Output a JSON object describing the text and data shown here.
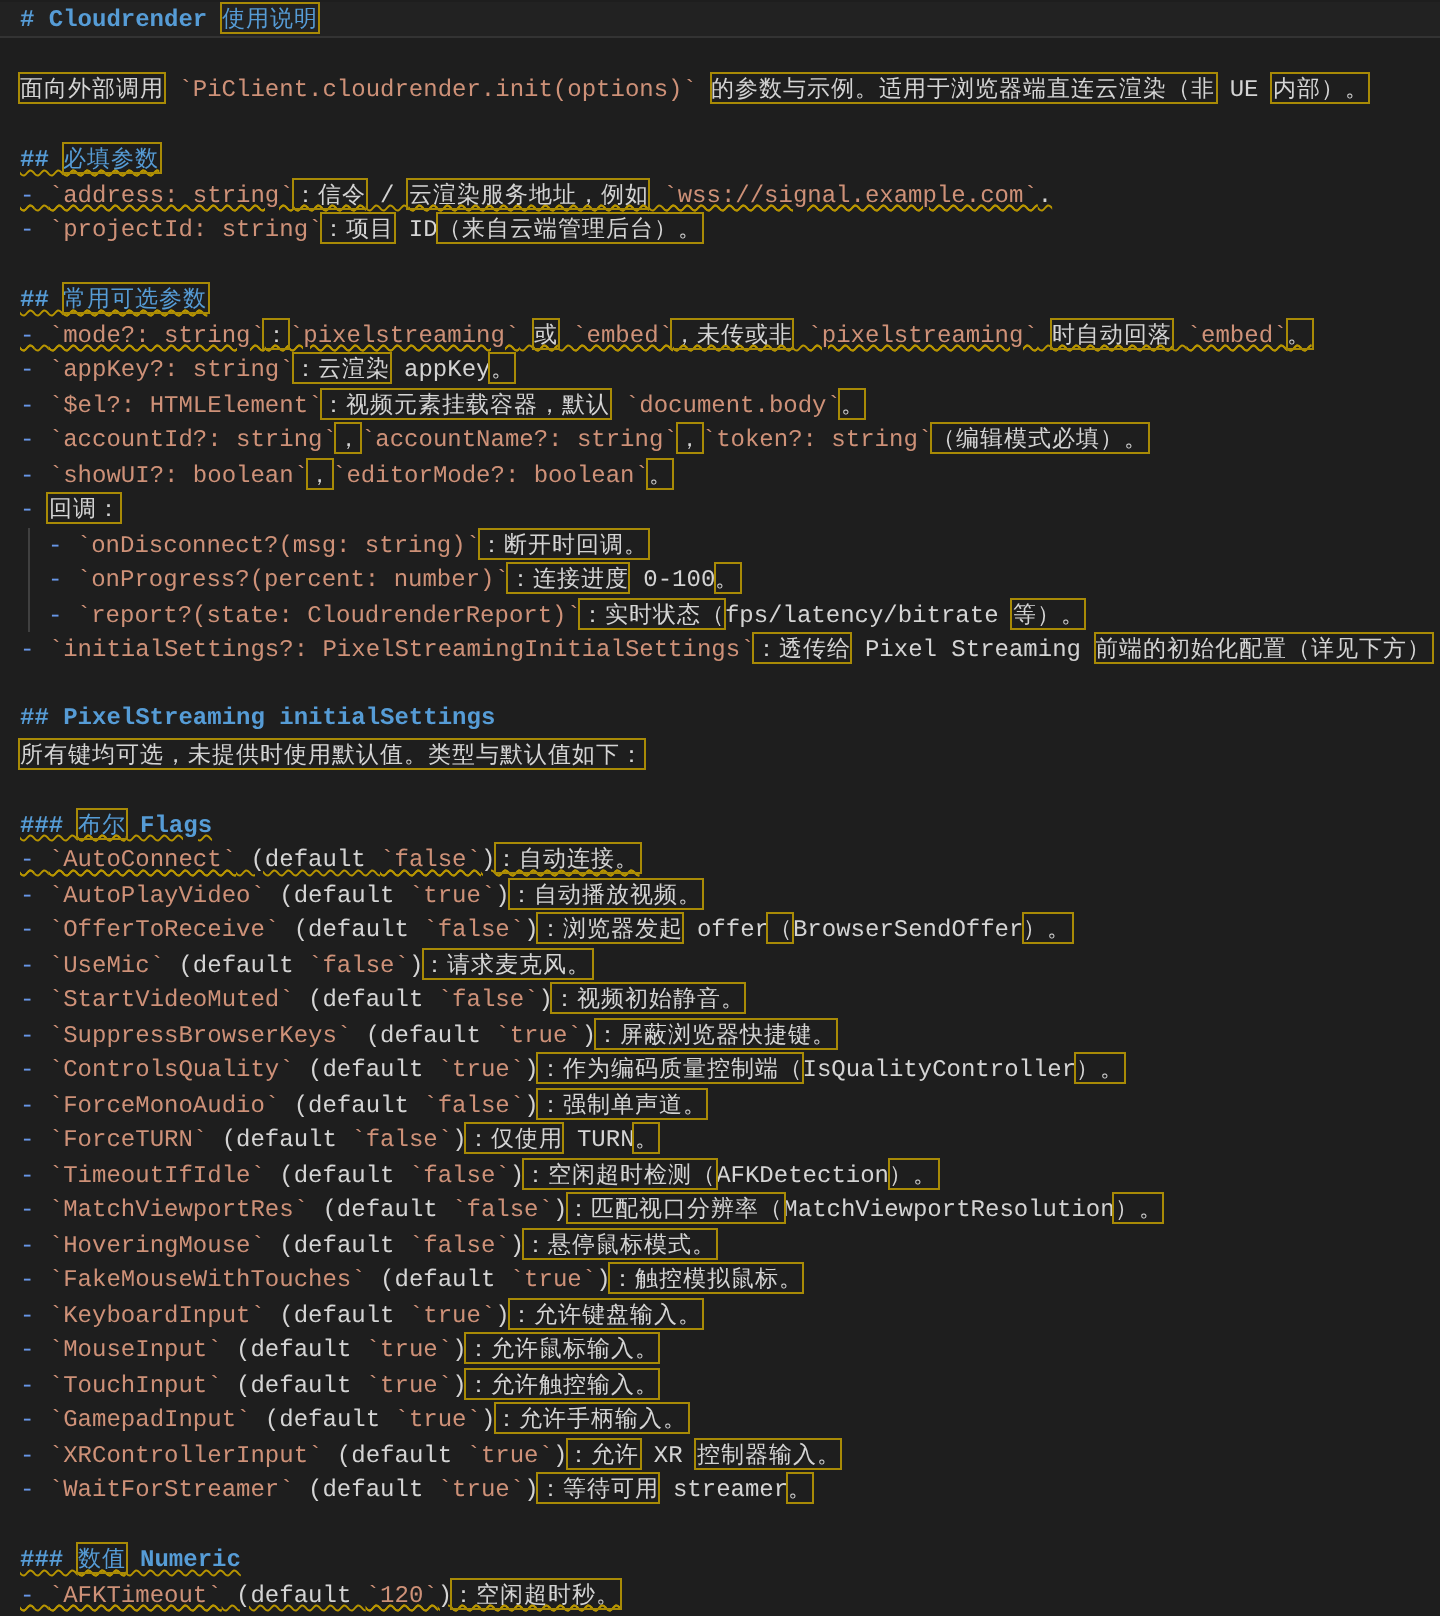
{
  "editor": {
    "lines": [
      {
        "kind": "h1",
        "text": "# Cloudrender 使用说明",
        "current": true,
        "warning": false
      },
      {
        "kind": "blank"
      },
      {
        "kind": "para",
        "text": "面向外部调用 `PiClient.cloudrender.init(options)` 的参数与示例。适用于浏览器端直连云渲染（非 UE 内部）。",
        "warning": false
      },
      {
        "kind": "blank"
      },
      {
        "kind": "h2",
        "text": "## 必填参数",
        "warning": true
      },
      {
        "kind": "item",
        "text": "- `address: string`：信令 / 云渲染服务地址，例如 `wss://signal.example.com`.",
        "warning": true
      },
      {
        "kind": "item",
        "text": "- `projectId: string`：项目 ID（来自云端管理后台）。",
        "warning": false
      },
      {
        "kind": "blank"
      },
      {
        "kind": "h2",
        "text": "## 常用可选参数",
        "warning": true
      },
      {
        "kind": "item",
        "text": "- `mode?: string`：`pixelstreaming` 或 `embed`，未传或非 `pixelstreaming` 时自动回落 `embed`。",
        "warning": true
      },
      {
        "kind": "item",
        "text": "- `appKey?: string`：云渲染 appKey。",
        "warning": false
      },
      {
        "kind": "item",
        "text": "- `$el?: HTMLElement`：视频元素挂载容器，默认 `document.body`。",
        "warning": false
      },
      {
        "kind": "item",
        "text": "- `accountId?: string`，`accountName?: string`，`token?: string`（编辑模式必填）。",
        "warning": false
      },
      {
        "kind": "item",
        "text": "- `showUI?: boolean`，`editorMode?: boolean`。",
        "warning": false
      },
      {
        "kind": "item",
        "text": "- 回调：",
        "warning": false,
        "children": [
          {
            "kind": "item",
            "text": "- `onDisconnect?(msg: string)`：断开时回调。",
            "warning": false
          },
          {
            "kind": "item",
            "text": "- `onProgress?(percent: number)`：连接进度 0-100。",
            "warning": false
          },
          {
            "kind": "item",
            "text": "- `report?(state: CloudrenderReport)`：实时状态（fps/latency/bitrate 等）。",
            "warning": false
          }
        ]
      },
      {
        "kind": "item",
        "text": "- `initialSettings?: PixelStreamingInitialSettings`：透传给 Pixel Streaming 前端的初始化配置（详见下方）",
        "warning": false
      },
      {
        "kind": "blank"
      },
      {
        "kind": "h2",
        "text": "## PixelStreaming initialSettings",
        "warning": false
      },
      {
        "kind": "para",
        "text": "所有键均可选，未提供时使用默认值。类型与默认值如下：",
        "warning": false
      },
      {
        "kind": "blank"
      },
      {
        "kind": "h3",
        "text": "### 布尔 Flags",
        "warning": true
      },
      {
        "kind": "item",
        "text": "- `AutoConnect` (default `false`)：自动连接。",
        "warning": true
      },
      {
        "kind": "item",
        "text": "- `AutoPlayVideo` (default `true`)：自动播放视频。",
        "warning": false
      },
      {
        "kind": "item",
        "text": "- `OfferToReceive` (default `false`)：浏览器发起 offer（BrowserSendOffer）。",
        "warning": false
      },
      {
        "kind": "item",
        "text": "- `UseMic` (default `false`)：请求麦克风。",
        "warning": false
      },
      {
        "kind": "item",
        "text": "- `StartVideoMuted` (default `false`)：视频初始静音。",
        "warning": false
      },
      {
        "kind": "item",
        "text": "- `SuppressBrowserKeys` (default `true`)：屏蔽浏览器快捷键。",
        "warning": false
      },
      {
        "kind": "item",
        "text": "- `ControlsQuality` (default `true`)：作为编码质量控制端（IsQualityController）。",
        "warning": false
      },
      {
        "kind": "item",
        "text": "- `ForceMonoAudio` (default `false`)：强制单声道。",
        "warning": false
      },
      {
        "kind": "item",
        "text": "- `ForceTURN` (default `false`)：仅使用 TURN。",
        "warning": false
      },
      {
        "kind": "item",
        "text": "- `TimeoutIfIdle` (default `false`)：空闲超时检测（AFKDetection）。",
        "warning": false
      },
      {
        "kind": "item",
        "text": "- `MatchViewportRes` (default `false`)：匹配视口分辨率（MatchViewportResolution）。",
        "warning": false
      },
      {
        "kind": "item",
        "text": "- `HoveringMouse` (default `false`)：悬停鼠标模式。",
        "warning": false
      },
      {
        "kind": "item",
        "text": "- `FakeMouseWithTouches` (default `true`)：触控模拟鼠标。",
        "warning": false
      },
      {
        "kind": "item",
        "text": "- `KeyboardInput` (default `true`)：允许键盘输入。",
        "warning": false
      },
      {
        "kind": "item",
        "text": "- `MouseInput` (default `true`)：允许鼠标输入。",
        "warning": false
      },
      {
        "kind": "item",
        "text": "- `TouchInput` (default `true`)：允许触控输入。",
        "warning": false
      },
      {
        "kind": "item",
        "text": "- `GamepadInput` (default `true`)：允许手柄输入。",
        "warning": false
      },
      {
        "kind": "item",
        "text": "- `XRControllerInput` (default `true`)：允许 XR 控制器输入。",
        "warning": false
      },
      {
        "kind": "item",
        "text": "- `WaitForStreamer` (default `true`)：等待可用 streamer。",
        "warning": false
      },
      {
        "kind": "blank"
      },
      {
        "kind": "h3",
        "text": "### 数值 Numeric",
        "warning": true
      },
      {
        "kind": "item",
        "text": "- `AFKTimeout` (default `120`)：空闲超时秒。",
        "warning": true
      }
    ]
  }
}
